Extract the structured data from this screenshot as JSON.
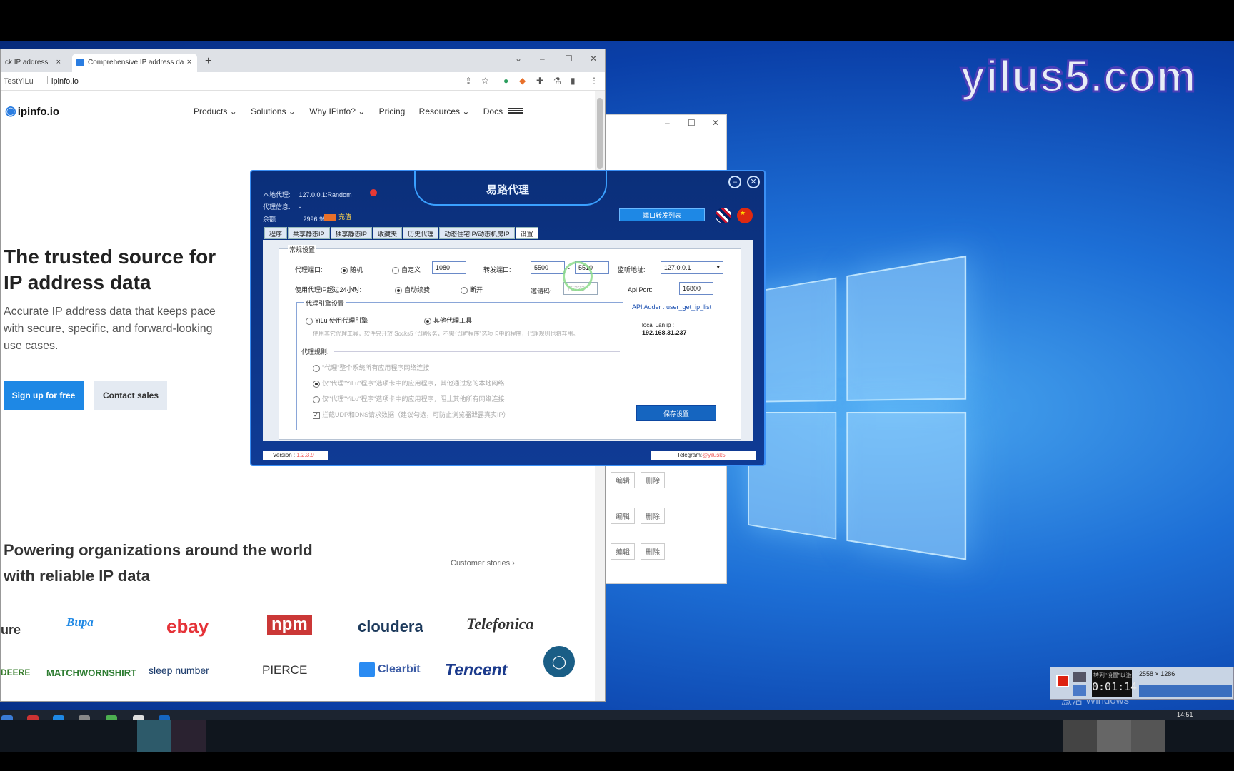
{
  "watermark": "yilus5.com",
  "desktop": {
    "activate_text": "激活 Windows"
  },
  "browser": {
    "tab1": "ck IP address",
    "tab2": "Comprehensive IP address da",
    "tab_close": "×",
    "new_tab": "+",
    "profile": "TestYiLu",
    "url": "ipinfo.io",
    "win_min": "–",
    "win_max": "☐",
    "win_close": "✕"
  },
  "site": {
    "logo": "ipinfo.io",
    "nav": [
      "Products ⌄",
      "Solutions ⌄",
      "Why IPinfo? ⌄",
      "Pricing",
      "Resources ⌄",
      "Docs"
    ],
    "hero_title": "The trusted source for IP address data",
    "hero_sub": "Accurate IP address data that keeps pace with secure, specific, and forward-looking use cases.",
    "signup": "Sign up for free",
    "contact": "Contact sales",
    "power_title": "Powering organizations around the world with reliable IP data",
    "customer_stories": "Customer stories ›",
    "brands_row1": [
      "ure",
      "Bupa",
      "ebay",
      "npm",
      "cloudera",
      "Telefonica"
    ],
    "brands_row2": [
      "DEERE",
      "MATCHWORNSHIRT",
      "sleep number",
      "PIERCE",
      "Clearbit",
      "Tencent"
    ]
  },
  "bgwin": {
    "edit": "编辑",
    "delete": "删除"
  },
  "proxy": {
    "title": "易路代理",
    "local_proxy_label": "本地代理:",
    "local_proxy_value": "127.0.0.1:Random",
    "proxy_info_label": "代理信息:",
    "proxy_info_value": "-",
    "balance_label": "余额:",
    "balance_value": "2996.98",
    "recharge": "充值",
    "port_list_btn": "端口转发列表",
    "tabs": [
      "程序",
      "共享静态IP",
      "独享静态IP",
      "收藏夹",
      "历史代理",
      "动态住宅IP/动态机房IP",
      "设置"
    ],
    "section_general": "常规设置",
    "proxy_port_label": "代理端口:",
    "random": "随机",
    "custom": "自定义",
    "custom_port": "1080",
    "forward_port_label": "转发端口:",
    "forward_port_from": "5500",
    "forward_port_to": "5510",
    "dash": "-",
    "listen_addr_label": "监听地址:",
    "listen_addr_value": "127.0.0.1",
    "over24_label": "使用代理IP超过24小时:",
    "auto_renew": "自动续费",
    "disconnect": "断开",
    "invite_label": "邀请码:",
    "invite_value": "76223",
    "api_port_label": "Api Port:",
    "api_port_value": "16800",
    "api_adder_label": "API Adder :",
    "api_adder_value": "user_get_ip_list",
    "local_lan_label": "local Lan ip :",
    "local_lan_value": "192.168.31.237",
    "engine_section": "代理引擎设置",
    "engine_yilu": "YiLu 使用代理引擎",
    "engine_other": "其他代理工具",
    "engine_note": "使用其它代理工具，软件只开放 Socks5 代理服务，不需代理\"程序\"选项卡中的程序，代理规则也将弃用。",
    "rules_section": "代理规则:",
    "rule1": "\"代理\"整个系统所有应用程序网络连接",
    "rule2": "仅\"代理\"YiLu\"程序\"选项卡中的应用程序，其他通过您的本地网络",
    "rule3": "仅\"代理\"YiLu\"程序\"选项卡中的应用程序，阻止其他所有网络连接",
    "rule4": "拦截UDP和DNS请求数据（建议勾选，可防止浏览器泄露真实IP）",
    "save_btn": "保存设置",
    "version_label": "Version :",
    "version_value": "1.2.3.9",
    "telegram_label": "Telegram:",
    "telegram_value": "@yilusk5"
  },
  "recorder": {
    "time": "0:01:14",
    "resolution": "2558 × 1286",
    "hint": "转到\"设置\"以激活 W"
  },
  "taskbar": {
    "time": "14:51"
  }
}
